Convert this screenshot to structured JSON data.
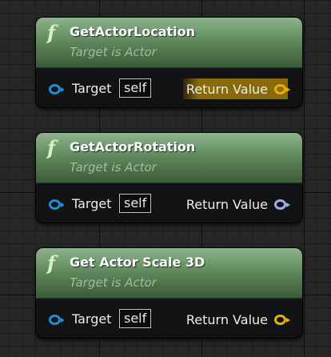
{
  "colors": {
    "canvas_bg": "#262626",
    "header_green": "#6e9a6b",
    "object_pin": "#1f8ed3",
    "vector_pin": "#e8b000",
    "rotator_pin": "#9eb0e6",
    "hover_highlight": "#8a6a08"
  },
  "nodes": [
    {
      "icon": "function-icon",
      "icon_glyph": "f",
      "title": "GetActorLocation",
      "subtitle": "Target is Actor",
      "input_label": "Target",
      "input_default": "self",
      "output_label": "Return Value",
      "output_type": "vector",
      "output_highlighted": true
    },
    {
      "icon": "function-icon",
      "icon_glyph": "f",
      "title": "GetActorRotation",
      "subtitle": "Target is Actor",
      "input_label": "Target",
      "input_default": "self",
      "output_label": "Return Value",
      "output_type": "rotator",
      "output_highlighted": false
    },
    {
      "icon": "function-icon",
      "icon_glyph": "f",
      "title": "Get Actor Scale 3D",
      "subtitle": "Target is Actor",
      "input_label": "Target",
      "input_default": "self",
      "output_label": "Return Value",
      "output_type": "vector",
      "output_highlighted": false
    }
  ]
}
